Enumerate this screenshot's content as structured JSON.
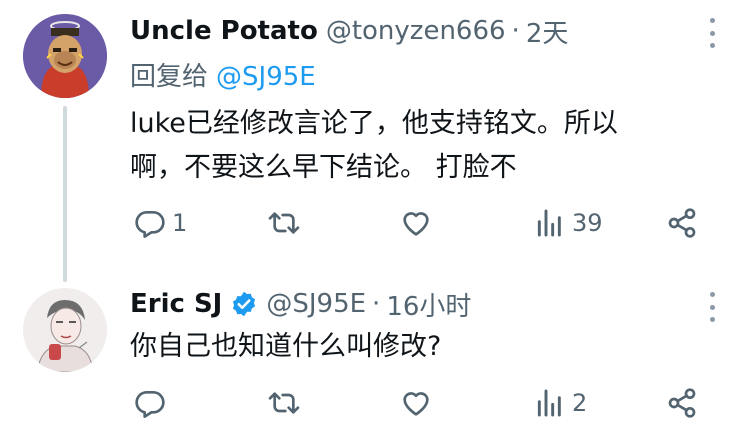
{
  "tweets": [
    {
      "display_name": "Uncle Potato",
      "handle": "@tonyzen666",
      "separator": "·",
      "time": "2天",
      "reply_to_label": "回复给",
      "reply_to_handle": "@SJ95E",
      "text_lines": [
        "luke已经修改言论了，他支持铭文。所以",
        "啊，不要这么早下结论。 打脸不"
      ],
      "avatar_icon": "ape-avatar",
      "actions": {
        "reply_count": "1",
        "retweet_count": "",
        "like_count": "",
        "views_count": "39"
      }
    },
    {
      "display_name": "Eric SJ",
      "verified": true,
      "handle": "@SJ95E",
      "separator": "·",
      "time": "16小时",
      "text_lines": [
        "你自己也知道什么叫修改?"
      ],
      "avatar_icon": "sketch-portrait-avatar",
      "actions": {
        "reply_count": "",
        "retweet_count": "",
        "like_count": "",
        "views_count": "2"
      }
    }
  ],
  "colors": {
    "primary_text": "#0f1419",
    "secondary_text": "#536471",
    "accent": "#1d9bf0",
    "thread_line": "#cfd9de"
  },
  "icons": [
    "reply-icon",
    "retweet-icon",
    "like-icon",
    "views-icon",
    "share-icon",
    "more-icon",
    "verified-badge-icon"
  ]
}
